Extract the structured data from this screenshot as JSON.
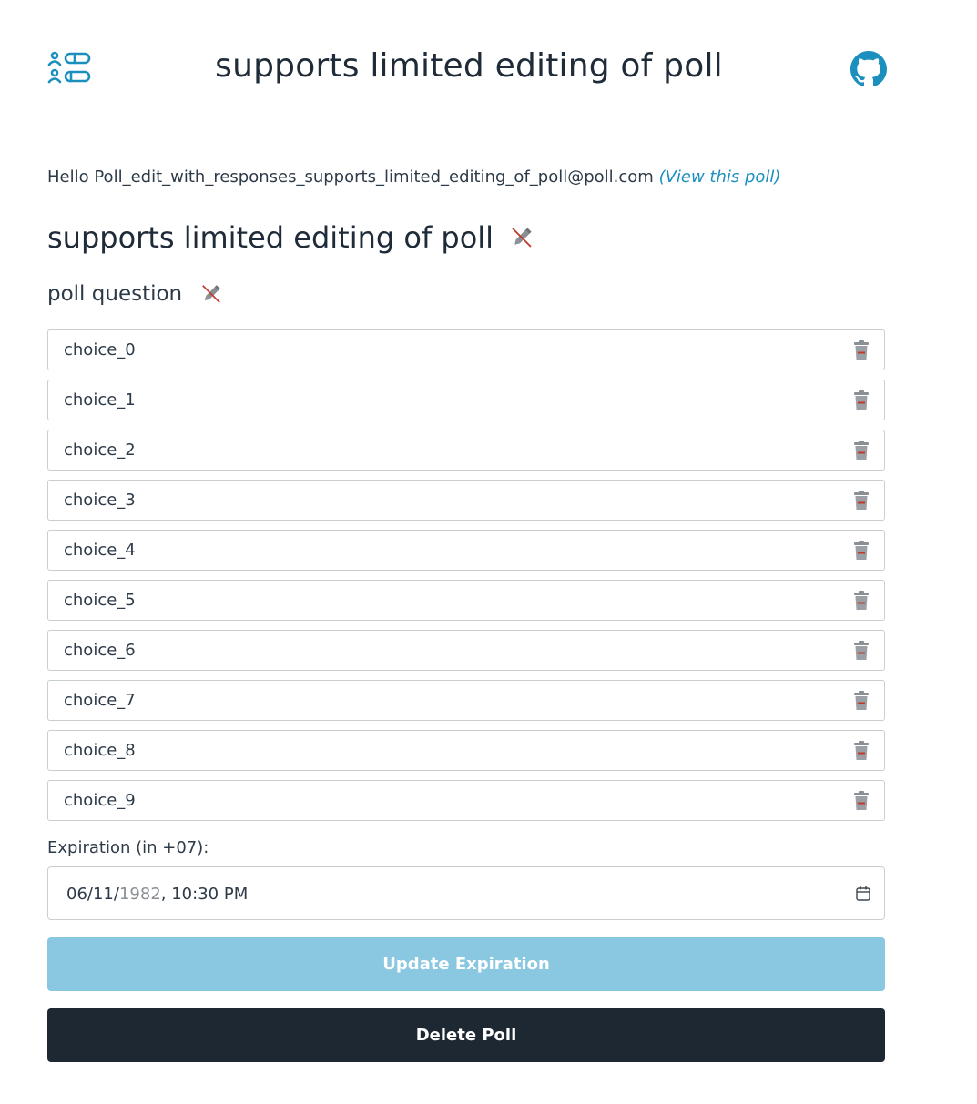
{
  "header": {
    "title": "supports limited editing of poll",
    "logo_icon": "poll-logo-icon",
    "github_icon": "github-icon"
  },
  "greeting": {
    "text": "Hello Poll_edit_with_responses_supports_limited_editing_of_poll@poll.com",
    "link": "(View this poll)"
  },
  "poll": {
    "title": "supports limited editing of poll",
    "question": "poll question",
    "choices": [
      "choice_0",
      "choice_1",
      "choice_2",
      "choice_3",
      "choice_4",
      "choice_5",
      "choice_6",
      "choice_7",
      "choice_8",
      "choice_9"
    ]
  },
  "expiration": {
    "label": "Expiration (in +07):",
    "month": "06",
    "day": "11",
    "year": "1982",
    "time": "10:30",
    "ampm": "PM"
  },
  "buttons": {
    "update": "Update Expiration",
    "delete": "Delete Poll"
  },
  "colors": {
    "accent": "#1b8fbd",
    "update_button": "#89c8e0",
    "delete_button": "#1d2833",
    "trash_red": "#c0392b"
  }
}
